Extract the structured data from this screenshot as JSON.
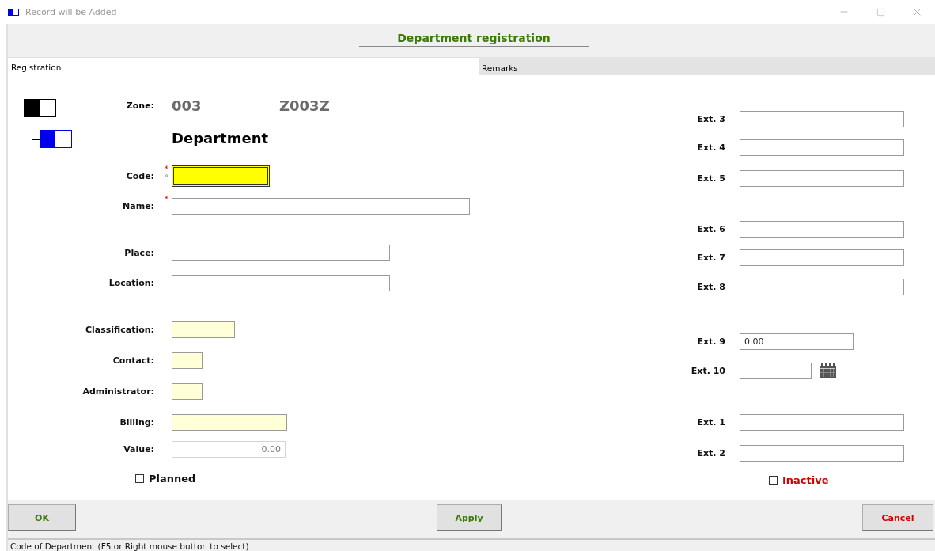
{
  "window": {
    "title": "Record will be Added"
  },
  "header": {
    "title": "Department registration"
  },
  "tabs": [
    {
      "label": "Registration",
      "selected": true
    },
    {
      "label": "Remarks",
      "selected": false
    }
  ],
  "zone": {
    "label": "Zone:",
    "code": "003",
    "value": "Z003Z"
  },
  "entity": "Department",
  "left_fields": [
    {
      "label": "Code:",
      "kind": "text",
      "required_mark": "*",
      "focused": true,
      "hint": "»"
    },
    {
      "label": "Name:",
      "kind": "text",
      "required_mark": "*",
      "focused": false
    },
    {
      "label": "Place:",
      "kind": "text",
      "focused": false
    },
    {
      "label": "Location:",
      "kind": "text",
      "focused": false
    },
    {
      "label": "Classification:",
      "kind": "lookup",
      "focused": false
    },
    {
      "label": "Contact:",
      "kind": "lookup",
      "focused": false
    },
    {
      "label": "Administrator:",
      "kind": "lookup",
      "focused": false
    },
    {
      "label": "Billing:",
      "kind": "lookup",
      "focused": false
    },
    {
      "label": "Value:",
      "kind": "number",
      "focused": false,
      "value": "0.00"
    }
  ],
  "checkboxes": [
    {
      "label": "Planned",
      "kind": "plain",
      "checked": false
    },
    {
      "label": "Inactive",
      "kind": "warning",
      "checked": false
    }
  ],
  "right_fields": [
    {
      "label": "Ext. 3",
      "kind": "text"
    },
    {
      "label": "Ext. 4",
      "kind": "text"
    },
    {
      "label": "Ext. 5",
      "kind": "text"
    },
    {
      "label": "Ext. 6",
      "kind": "text"
    },
    {
      "label": "Ext. 7",
      "kind": "text"
    },
    {
      "label": "Ext. 8",
      "kind": "text"
    },
    {
      "label": "Ext. 9",
      "kind": "amount",
      "value": "0.00"
    },
    {
      "label": "Ext. 10",
      "kind": "date"
    },
    {
      "label": "Ext. 1",
      "kind": "text"
    },
    {
      "label": "Ext. 2",
      "kind": "text"
    }
  ],
  "buttons": [
    {
      "label": "OK",
      "kind": "confirm"
    },
    {
      "label": "Apply",
      "kind": "confirm"
    },
    {
      "label": "Cancel",
      "kind": "cancel"
    }
  ],
  "status_bar": "Code of Department (F5 or Right mouse button to select)"
}
